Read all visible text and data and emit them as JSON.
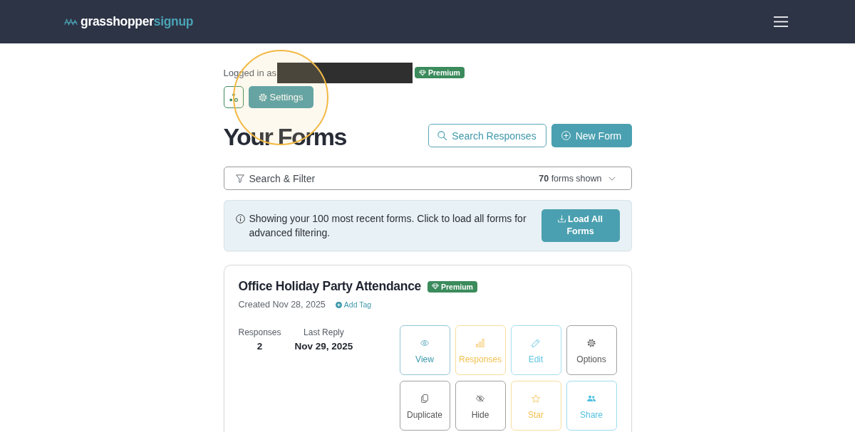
{
  "header": {
    "logo": {
      "part_1": "grasshopper",
      "part_2": "signup"
    }
  },
  "account": {
    "label": "Logged in as",
    "name_redacted": true,
    "badge": "Premium"
  },
  "toolbar": [
    {
      "kind": "nodes"
    },
    {
      "kind": "settings",
      "label": "Settings",
      "click_highlight": true
    }
  ],
  "page": {
    "title": "Your Forms",
    "buttons": [
      {
        "kind": "search",
        "label": "Search Responses"
      },
      {
        "kind": "new",
        "label": "New Form"
      }
    ]
  },
  "filter": {
    "label": "Search & Filter",
    "count": "**70** forms shown"
  },
  "notice": {
    "text": "Showing your 100 most recent forms. Click to load all forms for advanced filtering.",
    "button": "Load All Forms"
  },
  "forms": [
    {
      "title": "Office Holiday Party Attendance",
      "badge": "Premium",
      "created": "Created Nov 28, 2025",
      "add_tag": "Add Tag",
      "stats": [
        {
          "label": "Responses",
          "value": "2"
        },
        {
          "label": "Last Reply",
          "value": "Nov 29, 2025"
        }
      ],
      "actions": [
        {
          "kind": "view",
          "label": "View",
          "color": "#3a97ad"
        },
        {
          "kind": "responses",
          "label": "Responses",
          "color": "#f2c14e"
        },
        {
          "kind": "edit",
          "label": "Edit",
          "color": "#5ec5e3"
        },
        {
          "kind": "options",
          "label": "Options",
          "color": "#555555"
        },
        {
          "kind": "duplicate",
          "label": "Duplicate",
          "color": "#555555"
        },
        {
          "kind": "hide",
          "label": "Hide",
          "color": "#555555"
        },
        {
          "kind": "star",
          "label": "Star",
          "color": "#f2c14e"
        },
        {
          "kind": "share",
          "label": "Share",
          "color": "#4fc0e0"
        }
      ]
    }
  ]
}
